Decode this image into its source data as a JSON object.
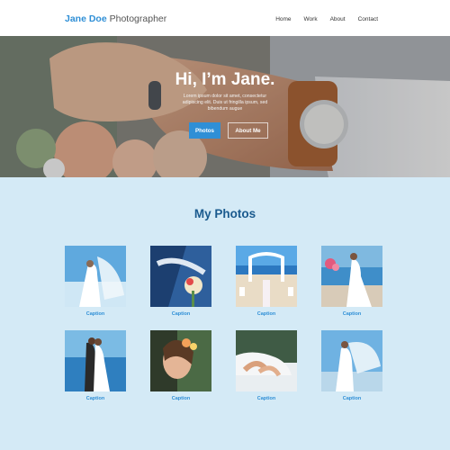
{
  "header": {
    "brand_first": "Jane Doe",
    "brand_rest": "Photographer",
    "nav": [
      "Home",
      "Work",
      "About",
      "Contact"
    ]
  },
  "hero": {
    "title": "Hi, I’m Jane.",
    "subtitle": "Lorem ipsum dolor sit amet, consectetur adipiscing elit. Duis ut fringilla ipsum, sed bibendum augue",
    "primary_button": "Photos",
    "secondary_button": "About Me"
  },
  "gallery": {
    "title": "My Photos",
    "photos": [
      {
        "caption": "Caption",
        "subject": "bride-veil-ocean"
      },
      {
        "caption": "Caption",
        "subject": "bouquet-on-car"
      },
      {
        "caption": "Caption",
        "subject": "beach-ceremony-arch"
      },
      {
        "caption": "Caption",
        "subject": "bride-flowers-sea"
      },
      {
        "caption": "Caption",
        "subject": "couple-kissing-beach"
      },
      {
        "caption": "Caption",
        "subject": "bride-portrait-flowers"
      },
      {
        "caption": "Caption",
        "subject": "hands-rings-table"
      },
      {
        "caption": "Caption",
        "subject": "bride-veil-sky"
      }
    ]
  },
  "colors": {
    "accent": "#2f8fd6",
    "page_bg": "#d4eaf6",
    "heading": "#1a5a8e"
  }
}
